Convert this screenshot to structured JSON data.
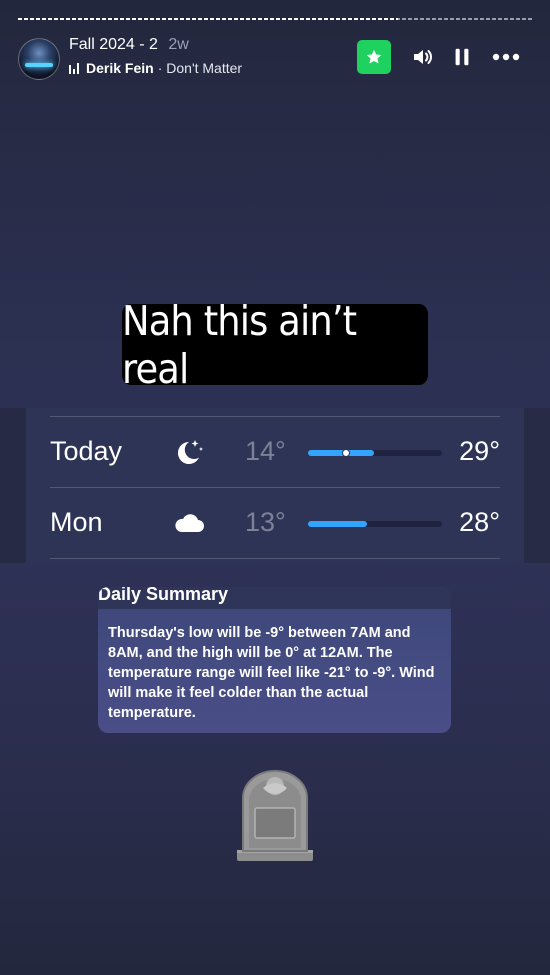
{
  "story": {
    "progress_fraction": 0.74,
    "title": "Fall 2024 - 2",
    "age": "2w",
    "artist": "Derik Fein",
    "song": "· Don't Matter"
  },
  "controls": {
    "favorite_icon": "star-icon",
    "favorite_color": "#1fd15e",
    "volume_icon": "speaker-icon",
    "pause_icon": "pause-icon",
    "more_icon": "more-icon"
  },
  "caption": "Nah this ain’t real",
  "weather": {
    "rows": [
      {
        "day": "Today",
        "icon": "moon-stars-icon",
        "low": "14°",
        "high": "29°",
        "range_start": 0.0,
        "range_end": 0.49,
        "current": 0.28
      },
      {
        "day": "Mon",
        "icon": "cloud-icon",
        "low": "13°",
        "high": "28°",
        "range_start": 0.0,
        "range_end": 0.44
      }
    ],
    "bar_color": "#33a5ff"
  },
  "summary": {
    "heading": "Daily Summary",
    "text": "Thursday's low will be -9° between 7AM and 8AM, and the high will be 0° at 12AM. The temperature range will feel like -21° to -9°. Wind will make it feel colder than the actual temperature."
  },
  "sticker": "headstone-icon"
}
